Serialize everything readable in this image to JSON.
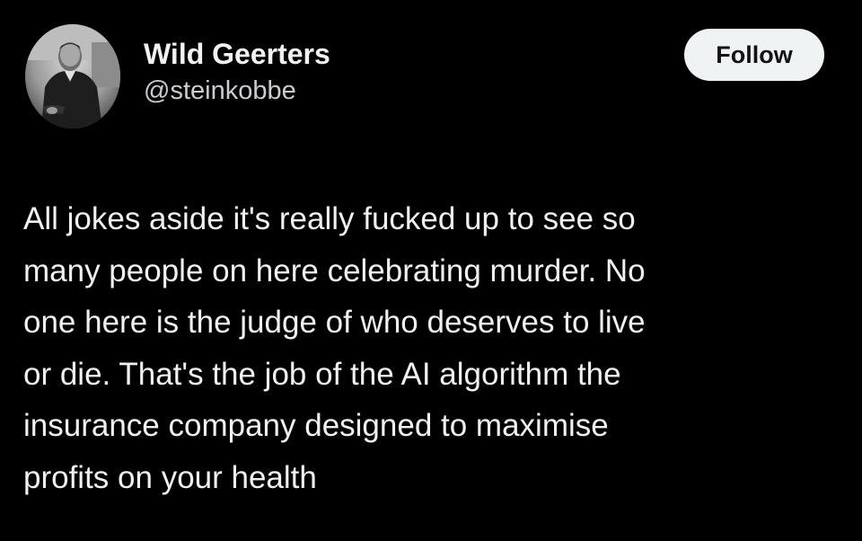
{
  "tweet": {
    "author": {
      "display_name": "Wild Geerters",
      "handle": "@steinkobbe",
      "avatar_icon": "profile-photo"
    },
    "follow_label": "Follow",
    "text": "All jokes aside it's really fucked up to see so\nmany people on here celebrating murder. No\none here is the judge of who deserves to live\nor die. That's the job of the AI algorithm the\ninsurance company designed to maximise\nprofits on your health"
  },
  "colors": {
    "background": "#000000",
    "text": "#f0f0f0",
    "follow_button_bg": "#eff3f4",
    "follow_button_text": "#0f1419"
  }
}
